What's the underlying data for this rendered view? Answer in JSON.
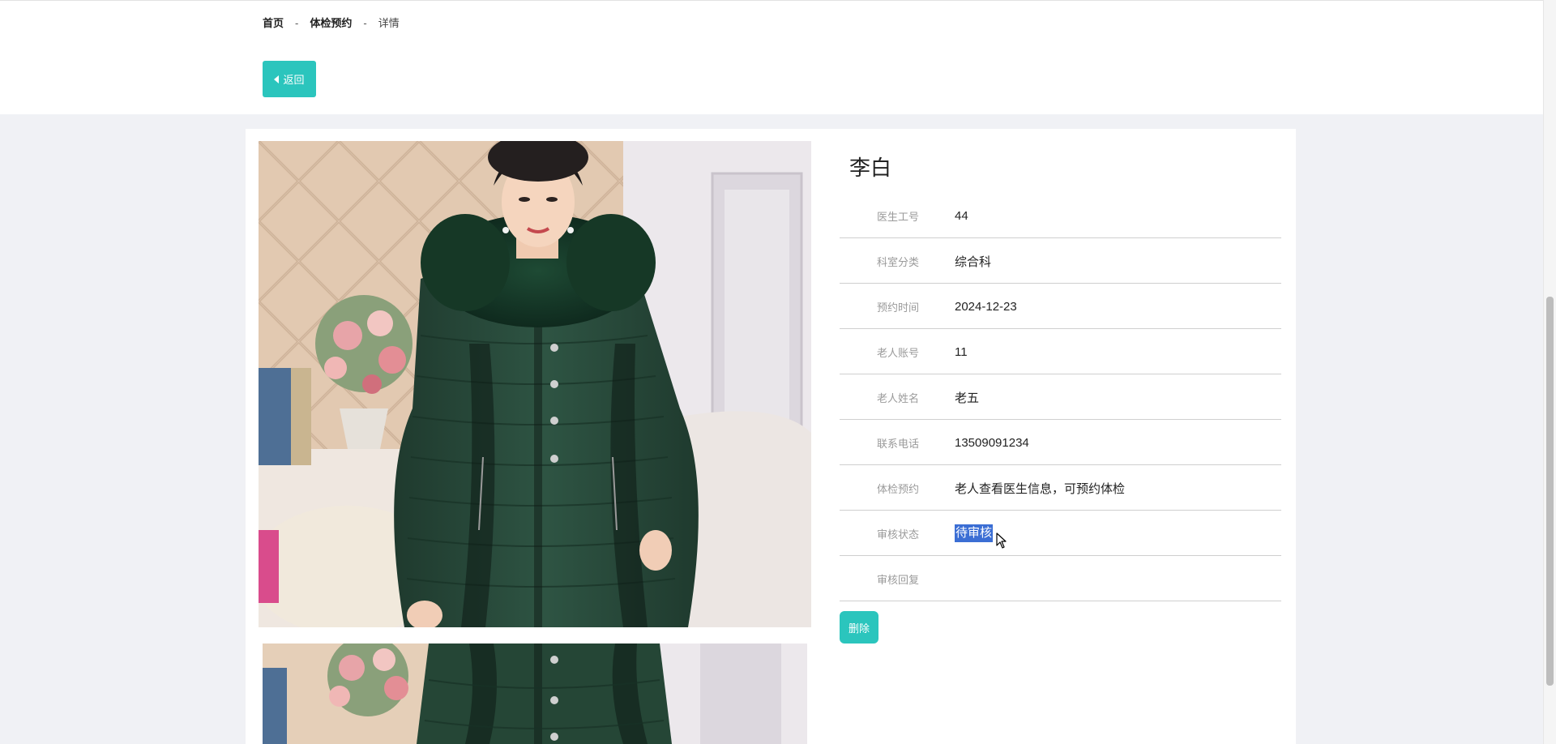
{
  "breadcrumb": {
    "home": "首页",
    "sep1": "-",
    "section": "体检预约",
    "sep2": "-",
    "current": "详情"
  },
  "back_button": {
    "label": "返回",
    "icon": "caret-left-icon"
  },
  "detail": {
    "title": "李白",
    "rows": [
      {
        "label": "医生工号",
        "value": "44"
      },
      {
        "label": "科室分类",
        "value": "综合科"
      },
      {
        "label": "预约时间",
        "value": "2024-12-23"
      },
      {
        "label": "老人账号",
        "value": "11"
      },
      {
        "label": "老人姓名",
        "value": "老五"
      },
      {
        "label": "联系电话",
        "value": "13509091234"
      },
      {
        "label": "体检预约",
        "value": "老人查看医生信息，可预约体检"
      },
      {
        "label": "审核状态",
        "value": "待审核"
      },
      {
        "label": "审核回复",
        "value": ""
      }
    ],
    "delete_label": "删除"
  },
  "colors": {
    "accent": "#2bc5bd",
    "selection": "#3b6ed4",
    "page_bg": "#f0f1f5"
  }
}
